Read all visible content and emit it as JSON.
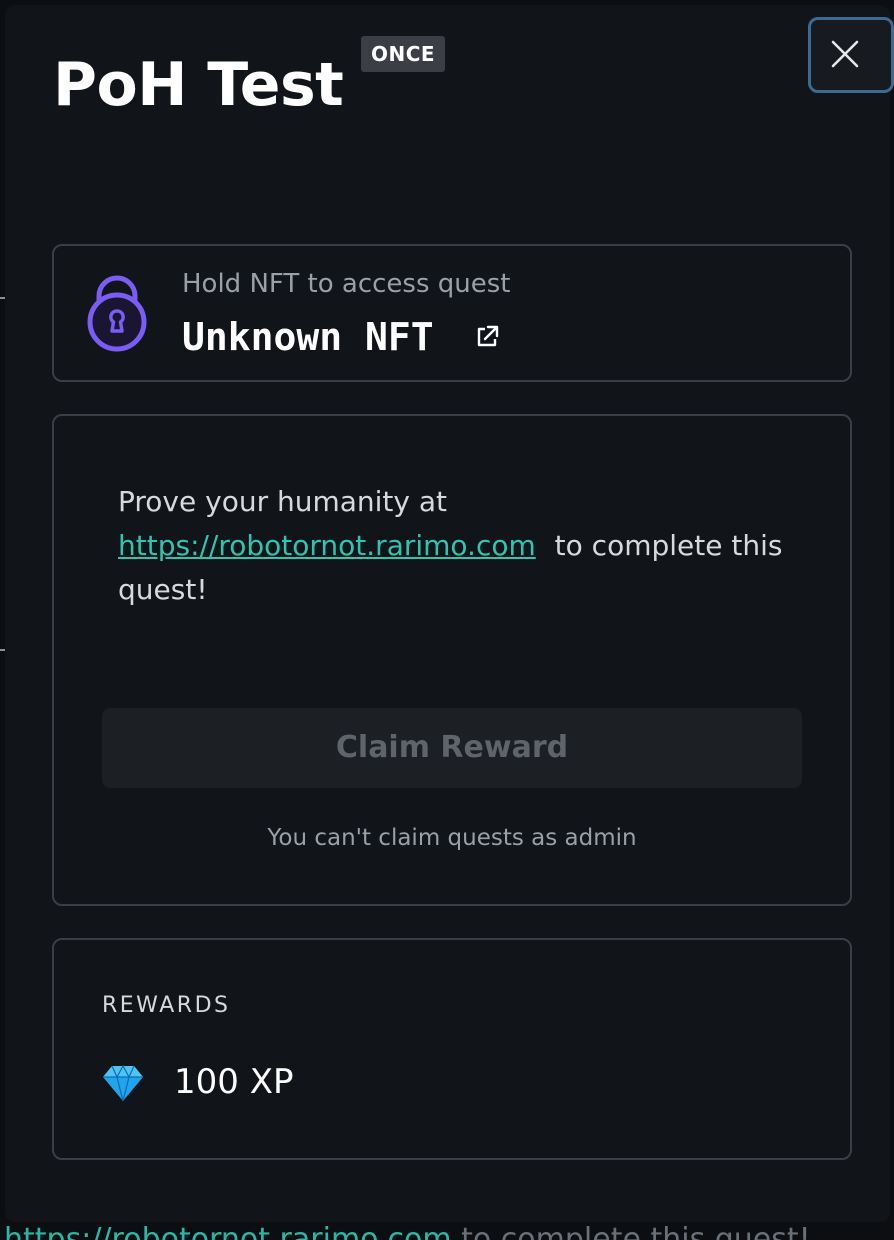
{
  "quest": {
    "title": "PoH Test",
    "frequency_badge": "ONCE"
  },
  "nft_requirement": {
    "caption": "Hold NFT to access quest",
    "name": "Unknown NFT",
    "lock_icon": "lock-icon",
    "link_icon": "external-link-icon"
  },
  "task": {
    "text_before": "Prove your humanity at",
    "link_text": "https://robotornot.rarimo.com",
    "text_after": "to complete this quest!",
    "claim_label": "Claim Reward",
    "claim_state": "disabled",
    "admin_note": "You can't claim quests as admin"
  },
  "rewards": {
    "heading": "REWARDS",
    "icon": "gem-icon",
    "value": "100 XP"
  },
  "colors": {
    "accent_link": "#2ec4ae",
    "lock": "#7b5cf5",
    "gem": "#22a3ee",
    "close_border": "#3d6a95"
  }
}
